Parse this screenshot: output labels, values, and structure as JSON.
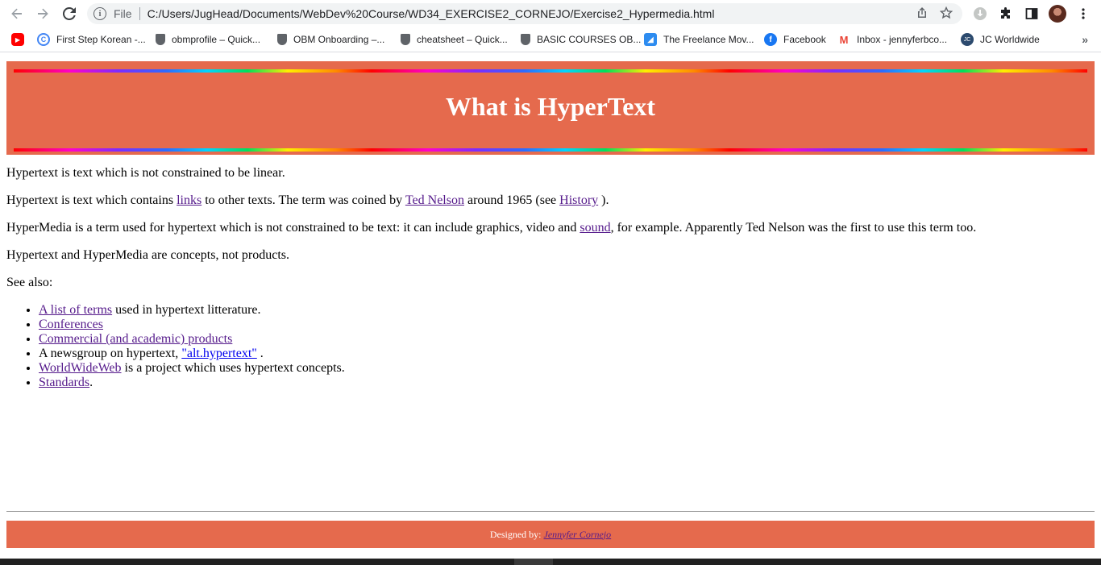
{
  "browser": {
    "url_scheme_label": "File",
    "url": "C:/Users/JugHead/Documents/WebDev%20Course/WD34_EXERCISE2_CORNEJO/Exercise2_Hypermedia.html",
    "bookmarks": [
      {
        "label": "",
        "icon": "youtube-icon"
      },
      {
        "label": "First Step Korean -...",
        "icon": "google-icon"
      },
      {
        "label": "obmprofile – Quick...",
        "icon": "shield-icon"
      },
      {
        "label": "OBM Onboarding –...",
        "icon": "shield-icon"
      },
      {
        "label": "cheatsheet – Quick...",
        "icon": "shield-icon"
      },
      {
        "label": "BASIC COURSES OB...",
        "icon": "shield-icon"
      },
      {
        "label": "The Freelance Mov...",
        "icon": "freelance-icon"
      },
      {
        "label": "Facebook",
        "icon": "facebook-icon"
      },
      {
        "label": "Inbox - jennyferbco...",
        "icon": "gmail-icon"
      },
      {
        "label": "JC Worldwide",
        "icon": "jc-icon"
      }
    ]
  },
  "header": {
    "title": "What is HyperText",
    "background_color": "#e56a4d"
  },
  "content": {
    "p1": "Hypertext is text which is not constrained to be linear.",
    "p2": {
      "before_links": "Hypertext is text which contains ",
      "links_label": "links",
      "mid1": " to other texts. The term was coined by ",
      "ted_nelson": "Ted Nelson",
      "mid2": " around 1965 (see ",
      "history": "History",
      "after": " )."
    },
    "p3": {
      "before": "HyperMedia is a term used for hypertext which is not constrained to be text: it can include graphics, video and ",
      "sound": "sound",
      "after": ", for example. Apparently Ted Nelson was the first to use this term too."
    },
    "p4": "Hypertext and HyperMedia are concepts, not products.",
    "p5": "See also:",
    "list": {
      "item1_link": "A list of terms",
      "item1_text": " used in hypertext litterature.",
      "item2_link": "Conferences",
      "item3_link": "Commercial (and academic) products",
      "item4_text": "A newsgroup on hypertext, ",
      "item4_link": "\"alt.hypertext\"",
      "item4_after": " .",
      "item5_link": "WorldWideWeb",
      "item5_text": " is a project which uses hypertext concepts.",
      "item6_link": "Standards",
      "item6_after": "."
    }
  },
  "footer": {
    "designed_by": "Designed by:",
    "author": "Jennyfer Cornejo"
  }
}
